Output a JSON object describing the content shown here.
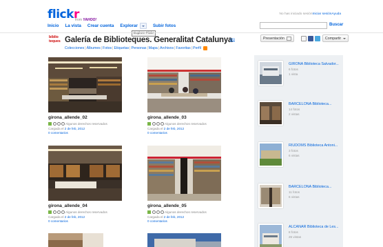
{
  "header": {
    "logo_text_a": "flick",
    "logo_text_b": "r",
    "logo_from": "from",
    "logo_brand": "YAHOO!",
    "nav": [
      {
        "label": "Inicio"
      },
      {
        "label": "La vista"
      },
      {
        "label": "Crear cuenta"
      },
      {
        "label": "Explorar"
      },
      {
        "label": "Subir fotos"
      }
    ],
    "tooltip": "Explore Flickr",
    "account": {
      "status": "No has iniciado sesión",
      "signin": "Iniciar sesión",
      "help": "Ayuda"
    },
    "search": {
      "placeholder": "",
      "button": "Buscar"
    }
  },
  "gallery": {
    "badge_line1": "biblio",
    "badge_line2": "teques",
    "title": "Galería de Biblioteques. Generalitat Catalunya",
    "pro": "pro",
    "subnav": [
      "Colecciones",
      "Álbumes",
      "Fotos",
      "Etiquetas",
      "Personas",
      "Mapa",
      "Archivos",
      "Favoritas",
      "Perfil"
    ],
    "presentation_button": "Presentación",
    "share_button": "Compartir"
  },
  "photos": [
    {
      "title": "girona_allende_02",
      "license": "Algunos derechos reservados",
      "uploaded_prefix": "Cargada el",
      "date": "2 de feb, 2012",
      "comments": "0 comentarios"
    },
    {
      "title": "girona_allende_03",
      "license": "Algunos derechos reservados",
      "uploaded_prefix": "Cargada el",
      "date": "2 de feb, 2012",
      "comments": "0 comentarios"
    },
    {
      "title": "girona_allende_04",
      "license": "Algunos derechos reservados",
      "uploaded_prefix": "Cargada el",
      "date": "2 de feb, 2012",
      "comments": "0 comentarios"
    },
    {
      "title": "girona_allende_05",
      "license": "Algunos derechos reservados",
      "uploaded_prefix": "Cargada el",
      "date": "2 de feb, 2012",
      "comments": "0 comentarios"
    }
  ],
  "sidebar": {
    "galleries": [
      {
        "title": "GIRONA Biblioteca Salvador...",
        "photos": "6 fotos",
        "views": "1 vista"
      },
      {
        "title": "BARCELONA Biblioteca...",
        "photos": "14 fotos",
        "views": "2 vistas"
      },
      {
        "title": "RIUDOMS Biblioteca Antoni...",
        "photos": "3 fotos",
        "views": "6 vistas"
      },
      {
        "title": "BARCELONA Biblioteca...",
        "photos": "11 fotos",
        "views": "6 vistas"
      },
      {
        "title": "ALCANAR Biblioteca de Les...",
        "photos": "8 fotos",
        "views": "26 vistas"
      }
    ]
  },
  "colors": {
    "link": "#0063dc",
    "logo_pink": "#ff0084",
    "sidebar_bg": "#edf0f3",
    "license_green": "#7ab648"
  }
}
